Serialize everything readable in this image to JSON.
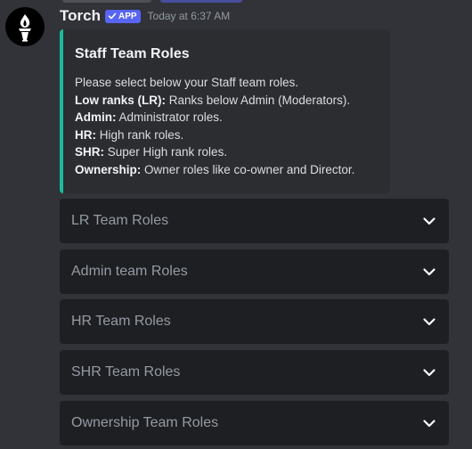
{
  "message": {
    "author": "Torch",
    "badge": "APP",
    "timestamp": "Today at 6:37 AM",
    "avatar_icon": "torch-icon"
  },
  "embed": {
    "accent_color": "#1abc9c",
    "title": "Staff Team Roles",
    "intro": "Please select below your Staff team roles.",
    "items": [
      {
        "term": "Low ranks (LR):",
        "desc": " Ranks below Admin (Moderators)."
      },
      {
        "term": "Admin:",
        "desc": " Administrator roles."
      },
      {
        "term": "HR:",
        "desc": " High rank roles."
      },
      {
        "term": "SHR:",
        "desc": " Super High rank roles."
      },
      {
        "term": "Ownership:",
        "desc": " Owner roles like co-owner and Director."
      }
    ]
  },
  "selects": [
    {
      "placeholder": "LR Team Roles"
    },
    {
      "placeholder": "Admin team Roles"
    },
    {
      "placeholder": "HR Team Roles"
    },
    {
      "placeholder": "SHR Team Roles"
    },
    {
      "placeholder": "Ownership Team Roles"
    }
  ]
}
